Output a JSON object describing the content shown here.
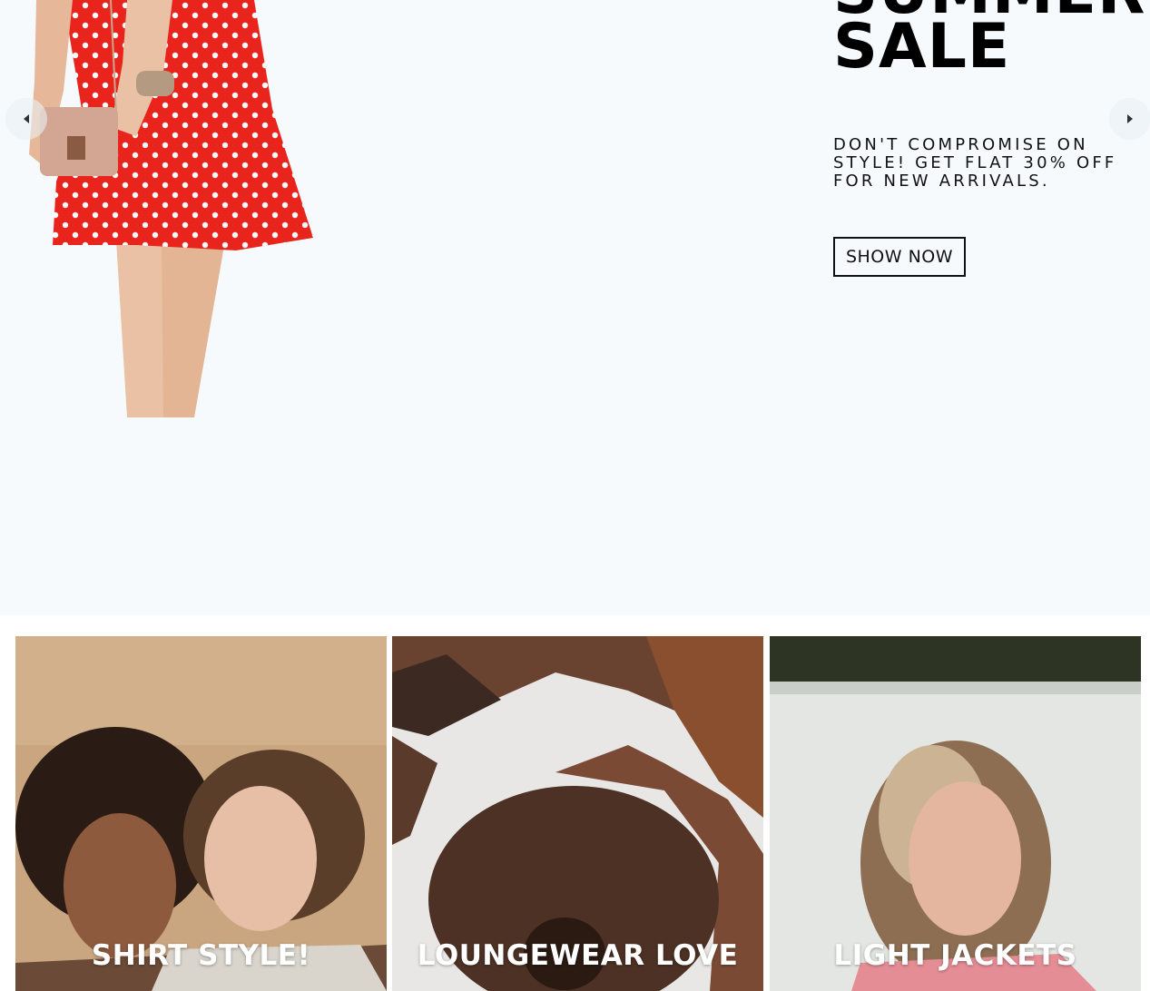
{
  "hero": {
    "title_line1": "SUMMER",
    "title_line2": "SALE",
    "subtitle": "DON'T COMPROMISE ON STYLE! GET FLAT 30% OFF FOR NEW ARRIVALS.",
    "cta_label": "SHOW NOW",
    "background": "#f6fafd",
    "dress_color": "#e8241c"
  },
  "slider": {
    "prev_icon": "caret-left-icon",
    "next_icon": "caret-right-icon"
  },
  "categories": [
    {
      "label": "SHIRT STYLE!",
      "image": "two-women-portrait"
    },
    {
      "label": "LOUNGEWEAR LOVE",
      "image": "woman-curly-hair-under-tree"
    },
    {
      "label": "LIGHT JACKETS",
      "image": "woman-blonde-bob-portrait"
    }
  ]
}
